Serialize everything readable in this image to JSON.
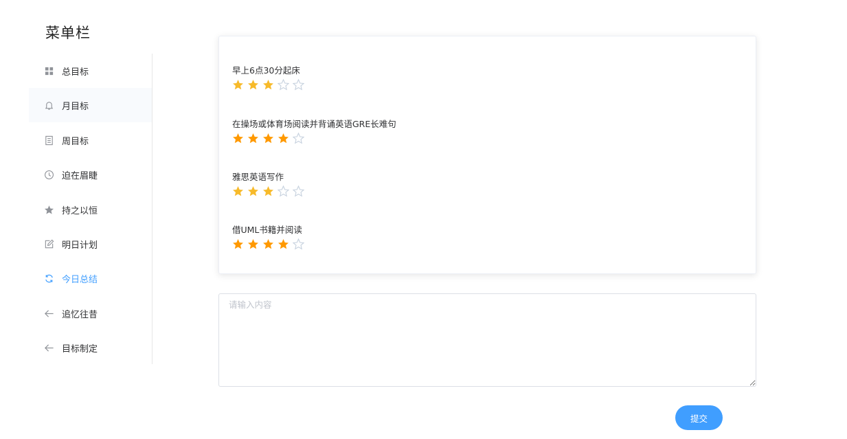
{
  "sidebar": {
    "title": "菜单栏",
    "items": [
      {
        "label": "总目标",
        "icon": "grid-icon"
      },
      {
        "label": "月目标",
        "icon": "bell-icon"
      },
      {
        "label": "周目标",
        "icon": "document-icon"
      },
      {
        "label": "迫在眉睫",
        "icon": "clock-icon"
      },
      {
        "label": "持之以恒",
        "icon": "star-icon"
      },
      {
        "label": "明日计划",
        "icon": "edit-icon"
      },
      {
        "label": "今日总结",
        "icon": "refresh-icon"
      },
      {
        "label": "追忆往昔",
        "icon": "arrow-left-icon"
      },
      {
        "label": "目标制定",
        "icon": "arrow-left-icon"
      }
    ],
    "active_item": "今日总结",
    "colors": {
      "active": "#409eff",
      "icon": "#909399"
    }
  },
  "goals": [
    {
      "title": "早上6点30分起床",
      "rating": 3,
      "max": 5
    },
    {
      "title": "在操场或体育场阅读并背诵英语GRE长难句",
      "rating": 4,
      "max": 5
    },
    {
      "title": "雅思英语写作",
      "rating": 3,
      "max": 5
    },
    {
      "title": "借UML书籍并阅读",
      "rating": 4,
      "max": 5
    }
  ],
  "star_colors": {
    "low": "#f7ba2a",
    "high": "#ff9900",
    "empty": "#c6d1de"
  },
  "summary": {
    "placeholder": "请输入内容",
    "value": ""
  },
  "submit_label": "提交"
}
